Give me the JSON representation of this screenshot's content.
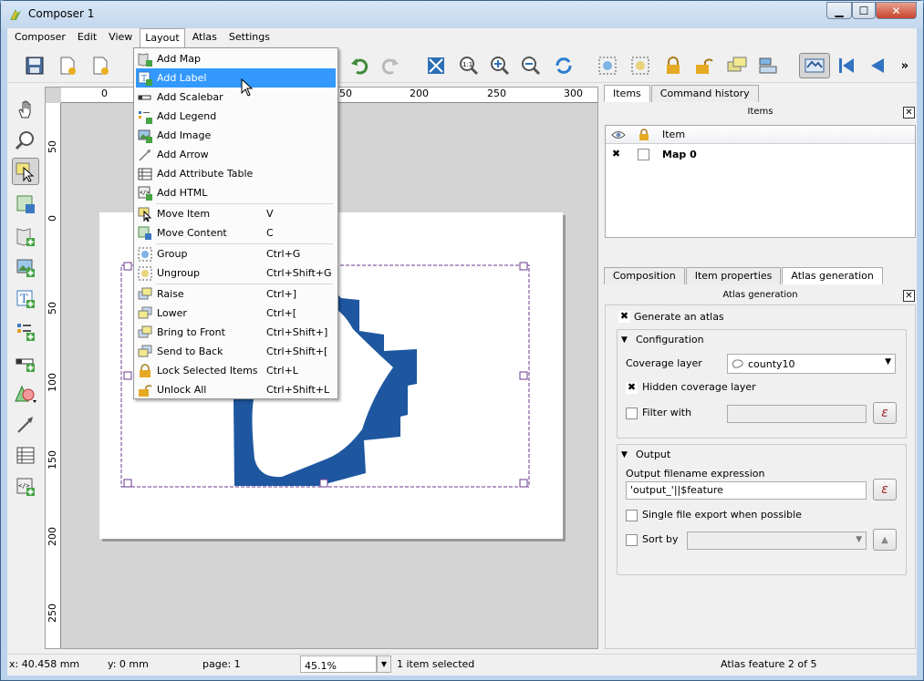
{
  "window": {
    "title": "Composer 1",
    "min": "▁",
    "max": "☐",
    "close": "✕"
  },
  "menubar": [
    "Composer",
    "Edit",
    "View",
    "Layout",
    "Atlas",
    "Settings"
  ],
  "ruler": {
    "h": [
      "0",
      "50",
      "200",
      "250",
      "300"
    ],
    "v": [
      "50",
      "0",
      "50",
      "100",
      "150",
      "200",
      "250"
    ]
  },
  "layout_menu": {
    "items": [
      {
        "label": "Add Map",
        "shortcut": ""
      },
      {
        "label": "Add Label",
        "shortcut": ""
      },
      {
        "label": "Add Scalebar",
        "shortcut": ""
      },
      {
        "label": "Add Legend",
        "shortcut": ""
      },
      {
        "label": "Add Image",
        "shortcut": ""
      },
      {
        "label": "Add Arrow",
        "shortcut": ""
      },
      {
        "label": "Add Attribute Table",
        "shortcut": ""
      },
      {
        "label": "Add HTML",
        "shortcut": ""
      },
      {
        "label": "Move Item",
        "shortcut": "V"
      },
      {
        "label": "Move Content",
        "shortcut": "C"
      },
      {
        "label": "Group",
        "shortcut": "Ctrl+G"
      },
      {
        "label": "Ungroup",
        "shortcut": "Ctrl+Shift+G"
      },
      {
        "label": "Raise",
        "shortcut": "Ctrl+]"
      },
      {
        "label": "Lower",
        "shortcut": "Ctrl+["
      },
      {
        "label": "Bring to Front",
        "shortcut": "Ctrl+Shift+]"
      },
      {
        "label": "Send to Back",
        "shortcut": "Ctrl+Shift+["
      },
      {
        "label": "Lock Selected Items",
        "shortcut": "Ctrl+L"
      },
      {
        "label": "Unlock All",
        "shortcut": "Ctrl+Shift+L"
      }
    ]
  },
  "panel": {
    "top_tabs": [
      "Items",
      "Command history"
    ],
    "items_title": "Items",
    "items_header": "Item",
    "items_rows": [
      {
        "name": "Map 0",
        "visible": "✖"
      }
    ],
    "bottom_tabs": [
      "Composition",
      "Item properties",
      "Atlas generation"
    ],
    "atlas_title": "Atlas generation",
    "generate": "Generate an atlas",
    "generate_check": "✖",
    "config_title": "Configuration",
    "coverage_label": "Coverage layer",
    "coverage_value": "county10",
    "hidden_label": "Hidden coverage layer",
    "hidden_check": "✖",
    "filter_label": "Filter with",
    "filter_value": "",
    "expr_btn": "ε",
    "output_title": "Output",
    "filename_label": "Output filename expression",
    "filename_value": "'output_'||$feature",
    "single_label": "Single file export when possible",
    "sort_label": "Sort by",
    "sort_value": "",
    "close": "✕"
  },
  "status": {
    "x": "x: 40.458 mm",
    "y": "y: 0 mm",
    "page": "page: 1",
    "zoom": "45.1%",
    "selected": "1 item selected",
    "atlas": "Atlas feature 2 of 5"
  },
  "colors": {
    "map_fill": "#1e57a0",
    "highlight": "#3399ff",
    "selection": "#6a3a8e"
  }
}
